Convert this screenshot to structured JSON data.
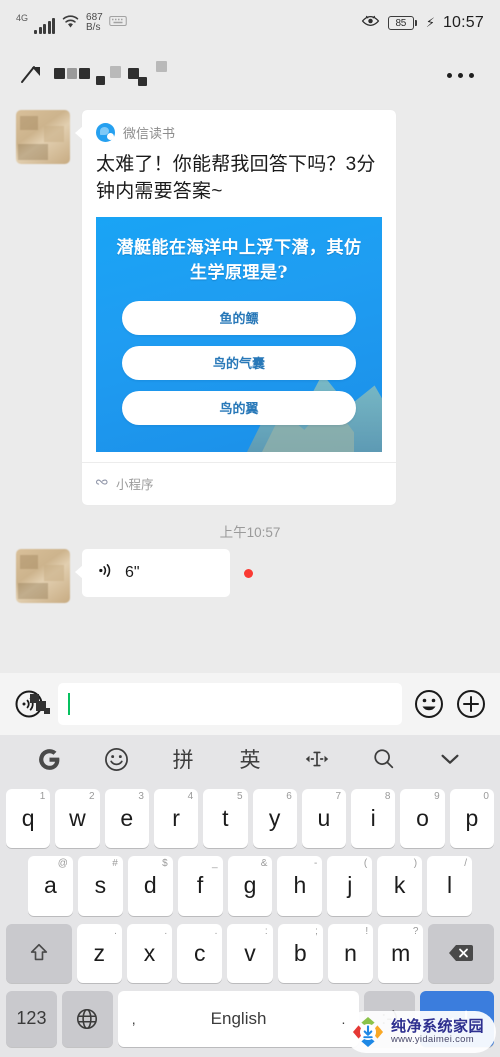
{
  "status_bar": {
    "network_type": "4G",
    "data_speed": "687",
    "data_speed_unit": "B/s",
    "battery_level": "85",
    "time": "10:57",
    "icons": [
      "signal-bars-icon",
      "wifi-icon",
      "keyboard-icon",
      "eye-icon",
      "battery-icon",
      "charging-bolt-icon"
    ]
  },
  "chat_header": {
    "back_label": "back-arrow",
    "contact_name": "",
    "menu_label": "more-options"
  },
  "message_card": {
    "source_app": "微信读书",
    "share_text": "太难了！你能帮我回答下吗？3分钟内需要答案~",
    "quiz_question": "潜艇能在海洋中上浮下潜，其仿生学原理是?",
    "quiz_options": [
      "鱼的鳔",
      "鸟的气囊",
      "鸟的翼"
    ],
    "footer_label": "小程序"
  },
  "timestamp": "上午10:57",
  "voice_message": {
    "duration": "6\"",
    "unread": true
  },
  "input_bar": {
    "text_value": "",
    "placeholder": "",
    "voice_button": "voice-input",
    "emoji_button": "emoji",
    "plus_button": "more"
  },
  "keyboard": {
    "toolbar": [
      {
        "name": "gboard-logo-icon",
        "label": "G"
      },
      {
        "name": "emoji-icon",
        "label": "☺"
      },
      {
        "name": "pinyin-mode",
        "label": "拼"
      },
      {
        "name": "english-mode",
        "label": "英"
      },
      {
        "name": "cursor-move-icon",
        "label": "◄I►"
      },
      {
        "name": "search-icon",
        "label": "🔍"
      },
      {
        "name": "collapse-keyboard-icon",
        "label": "⌄"
      }
    ],
    "row1": [
      {
        "key": "q",
        "hint": "1"
      },
      {
        "key": "w",
        "hint": "2"
      },
      {
        "key": "e",
        "hint": "3"
      },
      {
        "key": "r",
        "hint": "4"
      },
      {
        "key": "t",
        "hint": "5"
      },
      {
        "key": "y",
        "hint": "6"
      },
      {
        "key": "u",
        "hint": "7"
      },
      {
        "key": "i",
        "hint": "8"
      },
      {
        "key": "o",
        "hint": "9"
      },
      {
        "key": "p",
        "hint": "0"
      }
    ],
    "row2": [
      {
        "key": "a",
        "hint": "@"
      },
      {
        "key": "s",
        "hint": "#"
      },
      {
        "key": "d",
        "hint": "$"
      },
      {
        "key": "f",
        "hint": "_"
      },
      {
        "key": "g",
        "hint": "&"
      },
      {
        "key": "h",
        "hint": "-"
      },
      {
        "key": "j",
        "hint": "("
      },
      {
        "key": "k",
        "hint": ")"
      },
      {
        "key": "l",
        "hint": "/"
      }
    ],
    "row3": [
      {
        "key": "z",
        "hint": "."
      },
      {
        "key": "x",
        "hint": "."
      },
      {
        "key": "c",
        "hint": "."
      },
      {
        "key": "v",
        "hint": ":"
      },
      {
        "key": "b",
        "hint": ";"
      },
      {
        "key": "n",
        "hint": "!"
      },
      {
        "key": "m",
        "hint": "?"
      }
    ],
    "shift_label": "⇧",
    "backspace_label": "⌫",
    "numeric_label": "123",
    "globe_label": "globe",
    "space_label": "English",
    "space_comma": ",",
    "space_period": ".",
    "emoticon_label": ":-)",
    "enter_label": "enter"
  },
  "watermark": {
    "title": "纯净系统家园",
    "url": "www.yidaimei.com"
  },
  "colors": {
    "accent_blue": "#19a4f5",
    "enter_blue": "#3b7ddd",
    "unread_red": "#fa3a33",
    "caret_green": "#07c160",
    "chat_bg": "#ebebeb",
    "keyboard_bg": "#e5e5e7"
  }
}
